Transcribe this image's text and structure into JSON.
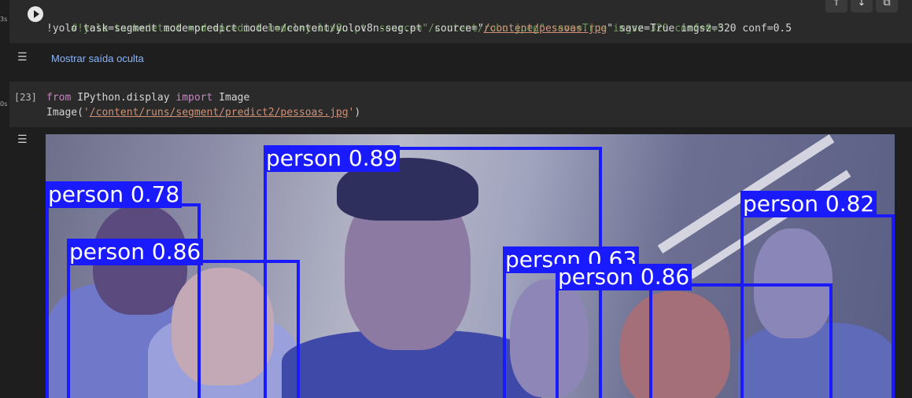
{
  "cell1": {
    "line1": "#!yolo task=detect mode=predict model=yolov8n.pt  source=\"/content/robo.jpeg\" save=True imgsz=320 conf=0.5",
    "line2_pre": "!yolo task=segment mode=predict model=/content/yolov8n-seg.pt  source=\"",
    "line2_path": "/content/pessoas.jpg",
    "line2_post": "\" save=True imgsz=320 conf=0.5"
  },
  "toolbar": {
    "up_icon": "arrow-up-icon",
    "down_icon": "arrow-down-icon",
    "link_icon": "link-icon"
  },
  "hidden_output": {
    "label": "Mostrar saída oculta"
  },
  "cell2": {
    "exec_count": "[23]",
    "kw_from": "from",
    "module": " IPython.display ",
    "kw_import": "import",
    "name": " Image",
    "call": "Image(",
    "quote_open": "'",
    "path": "/content/runs/segment/predict2/pessoas.jpg",
    "quote_close": "'",
    "call_close": ")"
  },
  "gutter": {
    "mark1": "3s",
    "mark2": "0s"
  },
  "output_image": {
    "detections": [
      {
        "label": "person 0.89"
      },
      {
        "label": "person 0.78"
      },
      {
        "label": "person 0.86"
      },
      {
        "label": "person 0.82"
      },
      {
        "label": "person 0.63"
      },
      {
        "label": "person 0.86"
      }
    ]
  },
  "colors": {
    "box": "#1a1aff",
    "mask": "#7f86d6"
  }
}
